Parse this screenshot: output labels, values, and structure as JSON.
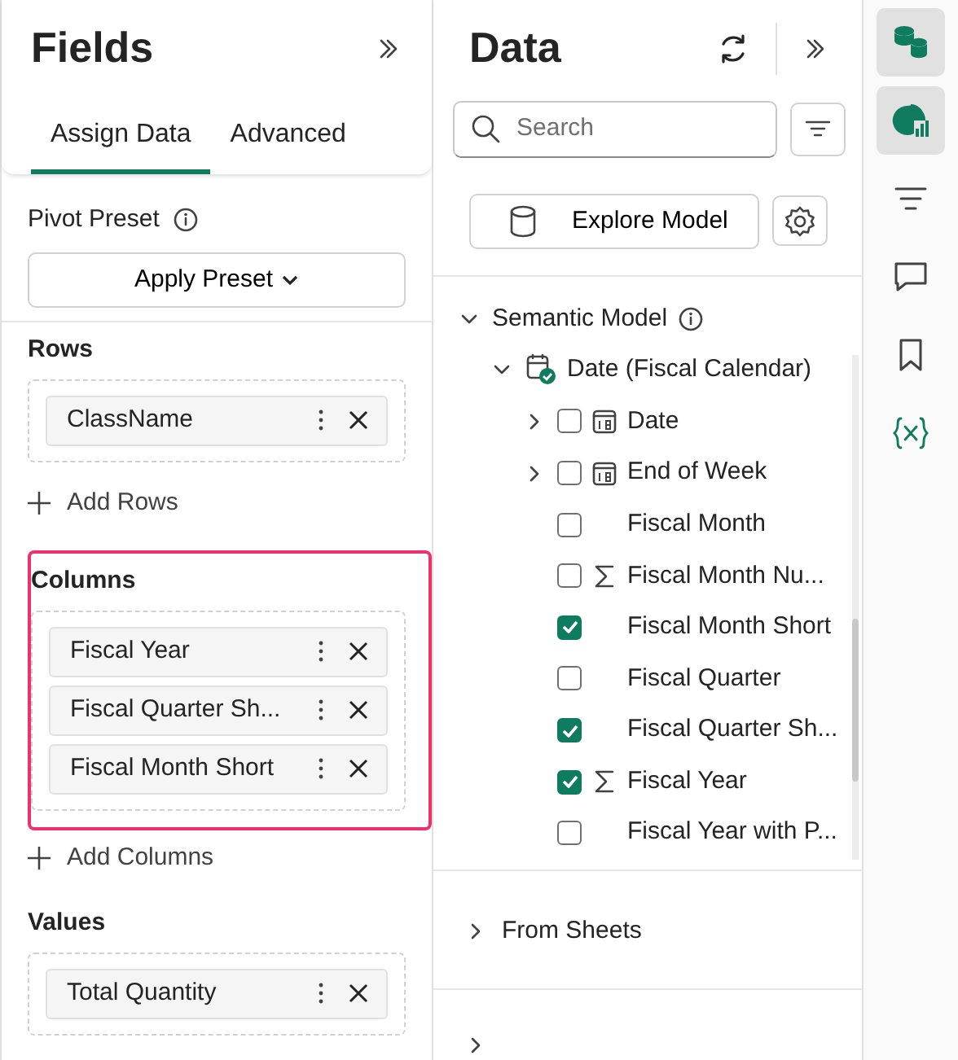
{
  "fields_panel": {
    "title": "Fields",
    "tabs": [
      {
        "label": "Assign Data",
        "selected": true
      },
      {
        "label": "Advanced",
        "selected": false
      }
    ],
    "pivot_preset": {
      "label": "Pivot Preset",
      "button": "Apply Preset"
    },
    "sections": [
      {
        "title": "Rows",
        "highlighted": false,
        "items": [
          "ClassName"
        ],
        "add": "Add Rows"
      },
      {
        "title": "Columns",
        "highlighted": true,
        "items": [
          "Fiscal Year",
          "Fiscal Quarter Sh...",
          "Fiscal Month Short"
        ],
        "add": "Add Columns"
      },
      {
        "title": "Values",
        "highlighted": false,
        "items": [
          "Total Quantity"
        ]
      }
    ]
  },
  "data_panel": {
    "title": "Data",
    "search": {
      "placeholder": "Search"
    },
    "explore_button": "Explore Model",
    "tree": [
      {
        "label": "Semantic Model",
        "expanded": true,
        "kind": "group",
        "children": [
          {
            "label": "Date (Fiscal Calendar)",
            "expanded": true,
            "kind": "table",
            "children": [
              {
                "label": "Date",
                "kind": "date",
                "expanded": false,
                "checked": false
              },
              {
                "label": "End of Week",
                "kind": "date",
                "expanded": false,
                "checked": false
              },
              {
                "label": "Fiscal Month",
                "kind": "text",
                "checked": false
              },
              {
                "label": "Fiscal Month Nu...",
                "kind": "sum",
                "checked": false
              },
              {
                "label": "Fiscal Month Short",
                "kind": "text",
                "checked": true
              },
              {
                "label": "Fiscal Quarter",
                "kind": "text",
                "checked": false
              },
              {
                "label": "Fiscal Quarter Sh...",
                "kind": "text",
                "checked": true
              },
              {
                "label": "Fiscal Year",
                "kind": "sum",
                "checked": true
              },
              {
                "label": "Fiscal Year with P...",
                "kind": "text",
                "checked": false
              }
            ]
          }
        ]
      }
    ],
    "sections": [
      {
        "label": "From Sheets",
        "expanded": false
      },
      {
        "expanded": false
      }
    ]
  },
  "rail": [
    {
      "kind": "data",
      "selected": true
    },
    {
      "kind": "chart",
      "selected": true
    },
    {
      "kind": "filter",
      "selected": false
    },
    {
      "kind": "comment",
      "selected": false
    },
    {
      "kind": "bookmark",
      "selected": false
    },
    {
      "kind": "variable",
      "selected": false
    }
  ]
}
